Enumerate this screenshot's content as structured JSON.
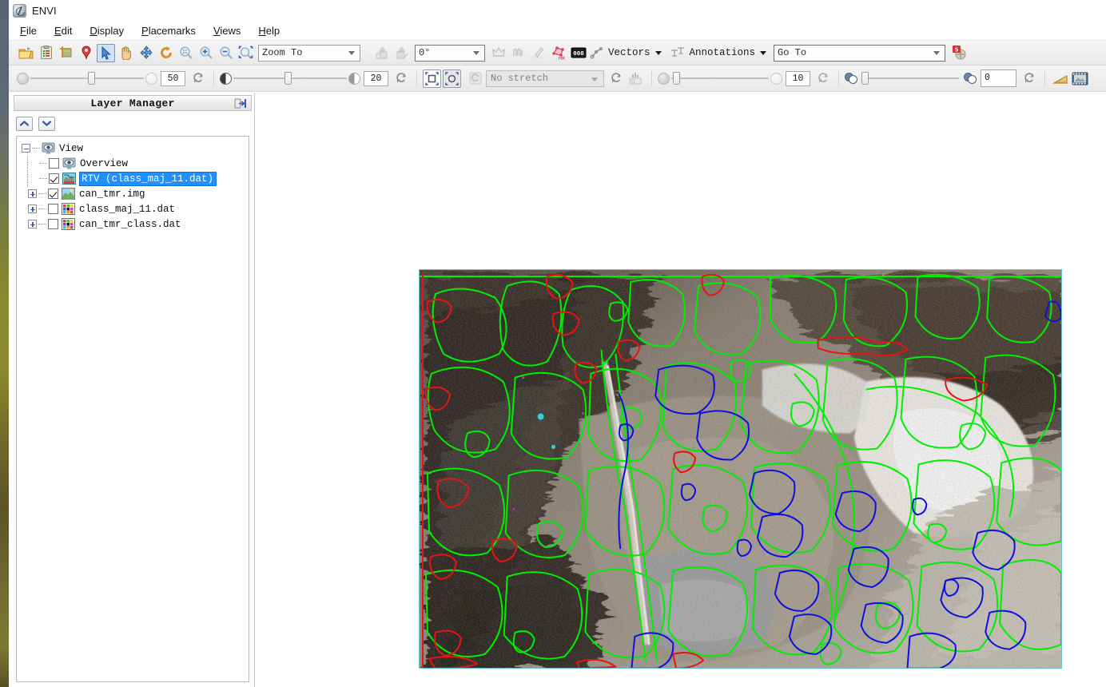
{
  "window": {
    "title": "ENVI",
    "logo_icon": "envi-logo-icon"
  },
  "menubar": {
    "items": [
      {
        "label": "File",
        "mnemonic": "F"
      },
      {
        "label": "Edit",
        "mnemonic": "E"
      },
      {
        "label": "Display",
        "mnemonic": "D"
      },
      {
        "label": "Placemarks",
        "mnemonic": "P"
      },
      {
        "label": "Views",
        "mnemonic": "V"
      },
      {
        "label": "Help",
        "mnemonic": "H"
      }
    ]
  },
  "toolbar_main": {
    "buttons": [
      {
        "name": "open-file-icon",
        "tooltip": "Open"
      },
      {
        "name": "clipboard-icon",
        "tooltip": "Data Manager"
      },
      {
        "name": "crop-image-icon",
        "tooltip": "Crop"
      },
      {
        "name": "placemark-pin-icon",
        "tooltip": "Placemark"
      },
      {
        "name": "select-cursor-icon",
        "tooltip": "Select",
        "selected": true
      },
      {
        "name": "pan-hand-icon",
        "tooltip": "Pan"
      },
      {
        "name": "fly-move-icon",
        "tooltip": "Fly"
      },
      {
        "name": "rotate-icon",
        "tooltip": "Rotate"
      },
      {
        "name": "zoom-fit-icon",
        "tooltip": "Zoom to Fit"
      },
      {
        "name": "zoom-in-icon",
        "tooltip": "Zoom In"
      },
      {
        "name": "zoom-out-icon",
        "tooltip": "Zoom Out"
      },
      {
        "name": "zoom-region-icon",
        "tooltip": "Zoom to Region"
      }
    ],
    "zoom_to": {
      "value": "Zoom To",
      "placeholder": "Zoom To"
    },
    "nav_buttons": [
      {
        "name": "previous-view-icon"
      },
      {
        "name": "next-view-icon"
      }
    ],
    "rotation": {
      "value": "0°"
    },
    "tool_icons": [
      {
        "name": "crown-annotation-icon"
      },
      {
        "name": "spectral-profile-icon"
      },
      {
        "name": "pencil-measure-icon"
      },
      {
        "name": "roi-tool-icon"
      },
      {
        "name": "density-slice-icon"
      }
    ],
    "vectors": {
      "label": "Vectors",
      "icon": "vector-icon"
    },
    "annotations": {
      "label": "Annotations",
      "icon": "text-annotation-icon"
    },
    "go_to": {
      "value": "Go To",
      "placeholder": "Go To"
    },
    "extension_icon": {
      "name": "envi-extensions-icon",
      "badge": "5"
    }
  },
  "toolbar_display": {
    "transparency": {
      "icon": "transparency-icon",
      "value_label": "50",
      "value": 50,
      "min": 0,
      "max": 100
    },
    "transparency_reset": {
      "name": "reset-transparency-icon"
    },
    "brightness": {
      "icon": "brightness-icon",
      "value_label": "20",
      "value": 20,
      "min": 0,
      "max": 100
    },
    "brightness_reset": {
      "name": "reset-brightness-icon"
    },
    "stretch_region": {
      "name": "stretch-on-view-icon",
      "selected": false
    },
    "stretch_extent": {
      "name": "stretch-on-extent-icon",
      "selected": true
    },
    "stretch_reset": {
      "name": "reset-stretch-icon"
    },
    "stretch_select": {
      "value": "No stretch",
      "placeholder": "No stretch"
    },
    "stretch_refresh": {
      "name": "refresh-stretch-icon"
    },
    "histogram": {
      "name": "histogram-icon"
    },
    "sharpen": {
      "icon": "sharpen-icon",
      "value_label": "10",
      "value": 10,
      "min": 0,
      "max": 100
    },
    "sharpen_reset": {
      "name": "reset-sharpen-icon"
    },
    "blend": {
      "icon": "blend-icon",
      "value_label": "0",
      "value": 0,
      "min": 0,
      "max": 100
    },
    "blend_reset": {
      "name": "reset-blend-icon"
    },
    "measure": {
      "name": "measurement-tool-icon"
    },
    "portal": {
      "name": "portal-icon"
    }
  },
  "layer_manager": {
    "title": "Layer Manager",
    "pin_icon": "dock-pin-icon",
    "move_up": {
      "name": "move-layer-up-button",
      "icon": "chevron-up-icon"
    },
    "move_down": {
      "name": "move-layer-down-button",
      "icon": "chevron-down-icon"
    },
    "tree": [
      {
        "label": "View",
        "level": 0,
        "icon": "view-eye-icon",
        "expander": "minus",
        "checkbox": null,
        "selected": false
      },
      {
        "label": "Overview",
        "level": 1,
        "icon": "overview-eye-icon",
        "expander": null,
        "checkbox": false,
        "selected": false
      },
      {
        "label": "RTV (class_maj_11.dat)",
        "level": 1,
        "icon": "raster-to-vector-icon",
        "expander": null,
        "checkbox": true,
        "selected": true
      },
      {
        "label": "can_tmr.img",
        "level": 1,
        "icon": "raster-image-icon",
        "expander": "plus",
        "checkbox": true,
        "selected": false
      },
      {
        "label": "class_maj_11.dat",
        "level": 1,
        "icon": "classification-icon",
        "expander": "plus",
        "checkbox": false,
        "selected": false
      },
      {
        "label": "can_tmr_class.dat",
        "level": 1,
        "icon": "classification-icon",
        "expander": "plus",
        "checkbox": false,
        "selected": false
      }
    ]
  },
  "view": {
    "name": "image-display-canvas",
    "image": {
      "description": "True-color satellite scene of an arid mountain valley with snow/bright alluvial fans, overlaid with raster-to-vector class boundaries",
      "border_color": "#63c6cc",
      "overlay_colors": {
        "class_green": "#00ee00",
        "class_blue": "#0000ee",
        "class_red": "#ee0000",
        "class_cyan": "#35c8c8"
      }
    }
  },
  "colors": {
    "selection_blue": "#1e90ff",
    "toolbar_bg": "#efefef",
    "window_bg": "#ffffff",
    "panel_border": "#b9b9b9"
  }
}
